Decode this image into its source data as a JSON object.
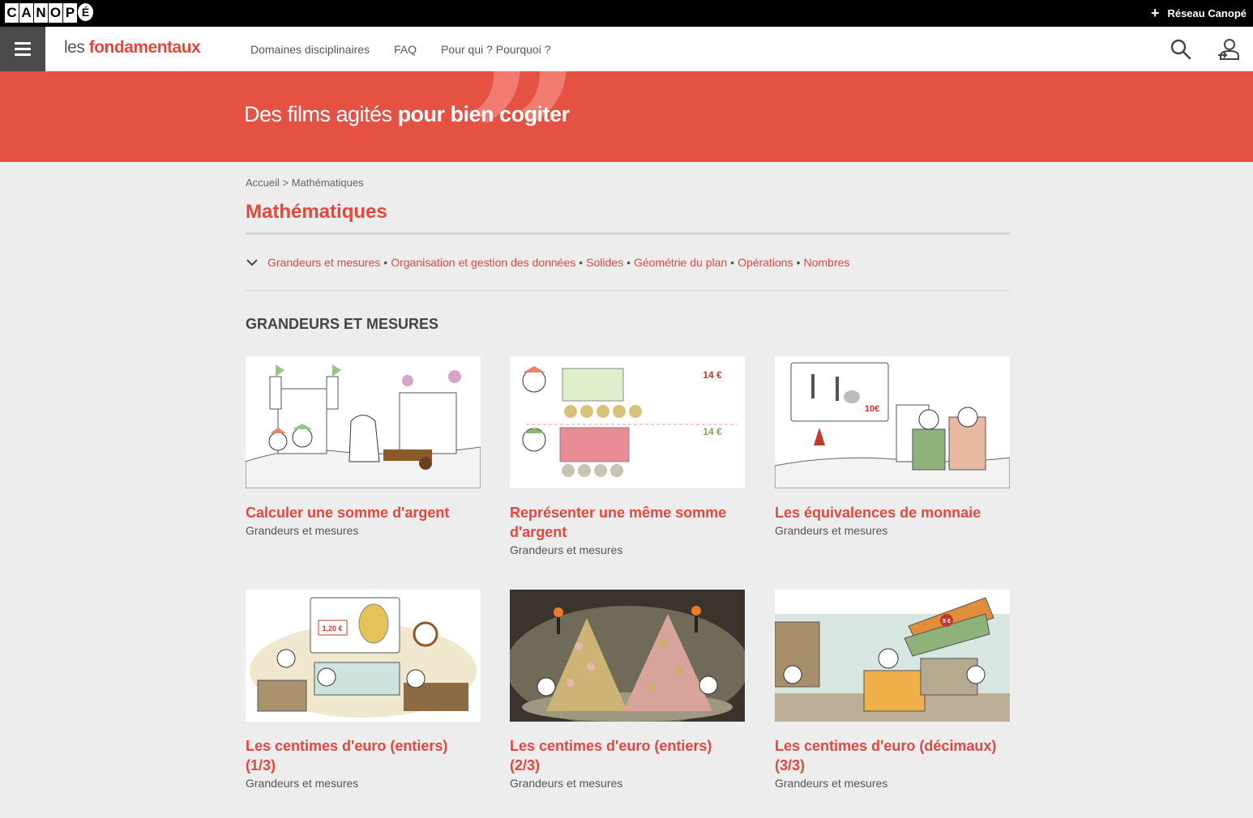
{
  "topbar": {
    "logo_letters": [
      "C",
      "A",
      "N",
      "O",
      "P",
      "É"
    ],
    "reseau_label": "Réseau Canopé"
  },
  "header": {
    "brand_les": "les",
    "brand_fond": "fondamentaux",
    "nav": [
      {
        "label": "Domaines disciplinaires"
      },
      {
        "label": "FAQ"
      },
      {
        "label": "Pour qui ? Pourquoi ?"
      }
    ]
  },
  "hero": {
    "slogan_light": "Des films agités ",
    "slogan_bold": "pour bien cogiter"
  },
  "breadcrumb": "Accueil > Mathématiques",
  "page_title": "Mathématiques",
  "filters": [
    "Grandeurs et mesures",
    "Organisation et gestion des données",
    "Solides",
    "Géométrie du plan",
    "Opérations",
    "Nombres"
  ],
  "section_title": "GRANDEURS ET MESURES",
  "cards": [
    {
      "title": "Calculer une somme d'argent",
      "subtitle": "Grandeurs et mesures"
    },
    {
      "title": "Représenter une même somme d'argent",
      "subtitle": "Grandeurs et mesures"
    },
    {
      "title": "Les équivalences de monnaie",
      "subtitle": "Grandeurs et mesures"
    },
    {
      "title": "Les centimes d'euro (entiers) (1/3)",
      "subtitle": "Grandeurs et mesures"
    },
    {
      "title": "Les centimes d'euro (entiers) (2/3)",
      "subtitle": "Grandeurs et mesures"
    },
    {
      "title": "Les centimes d'euro (décimaux) (3/3)",
      "subtitle": "Grandeurs et mesures"
    }
  ],
  "thumb_texts": {
    "price_14_a": "14 €",
    "price_14_b": "14 €",
    "price_10": "10€",
    "price_120": "1,20 €",
    "price_5": "5 €"
  },
  "colors": {
    "accent": "#e2483d",
    "hero_bg": "#e55142",
    "topbar": "#000000",
    "burger": "#4a4a4a"
  }
}
